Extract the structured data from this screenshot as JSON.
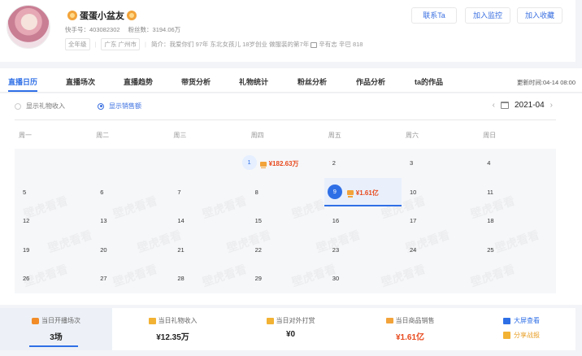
{
  "profile": {
    "name": "蛋蛋小盆友",
    "kuaishou_id_label": "快手号：",
    "kuaishou_id": "403082302",
    "fans_label": "粉丝数：",
    "fans": "3194.06万",
    "tags": [
      "全年级",
      "广东 广州市"
    ],
    "bio_label": "简介：",
    "bio": "我爱你们 97年 东北女孩儿 18岁创业 做服装的第7年 ",
    "bio_tail": "辛有志 辛巴 818"
  },
  "header_buttons": {
    "contact": "联系Ta",
    "monitor": "加入监控",
    "favorite": "加入收藏"
  },
  "tabs": [
    {
      "label": "直播日历",
      "active": true
    },
    {
      "label": "直播场次"
    },
    {
      "label": "直播趋势"
    },
    {
      "label": "带货分析"
    },
    {
      "label": "礼物统计"
    },
    {
      "label": "粉丝分析"
    },
    {
      "label": "作品分析"
    },
    {
      "label": "ta的作品"
    }
  ],
  "update_time": "更新时间:04-14 08:00",
  "options": {
    "gift_income": "显示礼物收入",
    "sales": "显示销售额"
  },
  "month": "2021-04",
  "weekdays": [
    "周一",
    "周二",
    "周三",
    "周四",
    "周五",
    "周六",
    "周日"
  ],
  "calendar": {
    "rows": [
      [
        null,
        null,
        null,
        {
          "day": "1",
          "amount": "¥182.63万"
        },
        {
          "day": "2"
        },
        {
          "day": "3"
        },
        {
          "day": "4"
        }
      ],
      [
        {
          "day": "5"
        },
        {
          "day": "6"
        },
        {
          "day": "7"
        },
        {
          "day": "8"
        },
        {
          "day": "9",
          "amount": "¥1.61亿",
          "selected": true
        },
        {
          "day": "10"
        },
        {
          "day": "11"
        }
      ],
      [
        {
          "day": "12"
        },
        {
          "day": "13"
        },
        {
          "day": "14"
        },
        {
          "day": "15"
        },
        {
          "day": "16"
        },
        {
          "day": "17"
        },
        {
          "day": "18"
        }
      ],
      [
        {
          "day": "19"
        },
        {
          "day": "20"
        },
        {
          "day": "21"
        },
        {
          "day": "22"
        },
        {
          "day": "23"
        },
        {
          "day": "24"
        },
        {
          "day": "25"
        }
      ],
      [
        {
          "day": "26"
        },
        {
          "day": "27"
        },
        {
          "day": "28"
        },
        {
          "day": "29"
        },
        {
          "day": "30"
        },
        null,
        null
      ]
    ]
  },
  "watermark_text": "壁虎看看",
  "stats": [
    {
      "label": "当日开播场次",
      "value": "3场",
      "icon": "video-icon"
    },
    {
      "label": "当日礼物收入",
      "value": "¥12.35万",
      "icon": "gift-icon"
    },
    {
      "label": "当日对外打赏",
      "value": "¥0",
      "icon": "gift-icon"
    },
    {
      "label": "当日商品销售",
      "value": "¥1.61亿",
      "icon": "cart-icon"
    }
  ],
  "side_links": {
    "big_screen": "大屏查看",
    "share": "分享战报"
  },
  "colors": {
    "accent": "#2f6fe6",
    "amount": "#e8491d"
  }
}
